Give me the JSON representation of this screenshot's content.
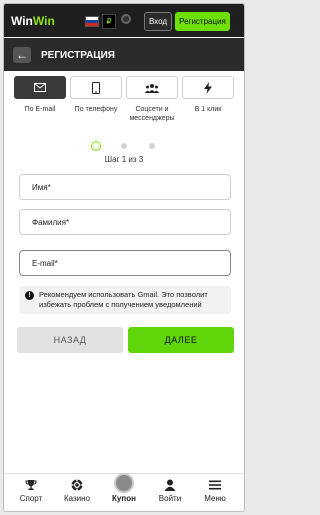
{
  "header": {
    "logo_part1": "Win",
    "logo_part2": "Win",
    "promo_label": "₽",
    "login_label": "Вход",
    "register_label": "Регистрация"
  },
  "title_bar": {
    "back_glyph": "←",
    "title": "РЕГИСТРАЦИЯ"
  },
  "methods": [
    {
      "label": "По E-mail",
      "icon": "envelope-icon",
      "active": true
    },
    {
      "label": "По телефону",
      "icon": "phone-icon",
      "active": false
    },
    {
      "label": "Соцсети и мессенджеры",
      "icon": "people-icon",
      "active": false
    },
    {
      "label": "В 1 клик",
      "icon": "lightning-icon",
      "active": false
    }
  ],
  "steps": {
    "text": "Шаг 1 из 3",
    "current": 1,
    "total": 3
  },
  "form": {
    "name_placeholder": "Имя*",
    "surname_placeholder": "Фамилия*",
    "email_placeholder": "E-mail*"
  },
  "notice": {
    "icon": "!",
    "text": "Рекомендуем использовать Gmail. Это позволит избежать проблем с получением уведомлений"
  },
  "buttons": {
    "back": "НАЗАД",
    "next": "ДАЛЕЕ"
  },
  "bottom_nav": [
    {
      "label": "Спорт",
      "icon": "trophy-icon"
    },
    {
      "label": "Казино",
      "icon": "chip-icon"
    },
    {
      "label": "Купон",
      "icon": "ticket-icon"
    },
    {
      "label": "Войти",
      "icon": "user-icon"
    },
    {
      "label": "Меню",
      "icon": "menu-icon"
    }
  ],
  "colors": {
    "accent_green": "#5fd60a",
    "header_dark": "#1f1f1f",
    "title_dark": "#2b2b2b"
  }
}
